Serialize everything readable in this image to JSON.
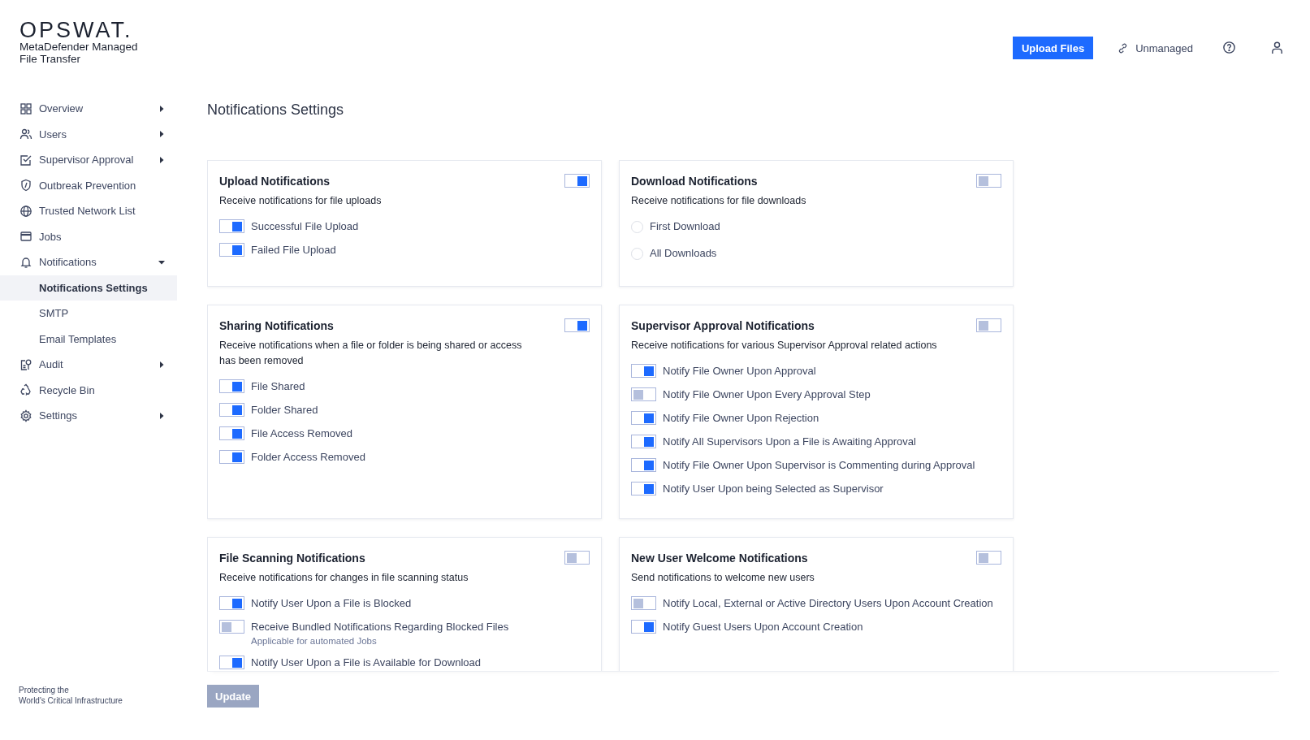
{
  "brand": {
    "logo": "OPSWAT.",
    "product_lines": [
      "MetaDefender Managed",
      "File Transfer"
    ]
  },
  "header": {
    "upload_button": "Upload Files",
    "status": "Unmanaged"
  },
  "sidebar": {
    "items": [
      {
        "label": "Overview",
        "has_submenu": true,
        "expanded": false
      },
      {
        "label": "Users",
        "has_submenu": true,
        "expanded": false
      },
      {
        "label": "Supervisor Approval",
        "has_submenu": true,
        "expanded": false
      },
      {
        "label": "Outbreak Prevention",
        "has_submenu": false
      },
      {
        "label": "Trusted Network List",
        "has_submenu": false
      },
      {
        "label": "Jobs",
        "has_submenu": false
      },
      {
        "label": "Notifications",
        "has_submenu": true,
        "expanded": true,
        "children": [
          {
            "label": "Notifications Settings",
            "selected": true
          },
          {
            "label": "SMTP",
            "selected": false
          },
          {
            "label": "Email Templates",
            "selected": false
          }
        ]
      },
      {
        "label": "Audit",
        "has_submenu": true,
        "expanded": false
      },
      {
        "label": "Recycle Bin",
        "has_submenu": false
      },
      {
        "label": "Settings",
        "has_submenu": true,
        "expanded": false
      }
    ],
    "footer_lines": [
      "Protecting the",
      "World's Critical Infrastructure"
    ]
  },
  "page": {
    "title": "Notifications Settings"
  },
  "cards": [
    {
      "title": "Upload Notifications",
      "on": true,
      "description": "Receive notifications for file uploads",
      "options": [
        {
          "kind": "toggle",
          "label": "Successful File Upload",
          "on": true
        },
        {
          "kind": "toggle",
          "label": "Failed File Upload",
          "on": true
        }
      ]
    },
    {
      "title": "Download Notifications",
      "on": false,
      "description": "Receive notifications for file downloads",
      "options": [
        {
          "kind": "radio",
          "label": "First Download",
          "selected": false
        },
        {
          "kind": "radio",
          "label": "All Downloads",
          "selected": false
        }
      ]
    },
    {
      "title": "Sharing Notifications",
      "on": true,
      "description": "Receive notifications when a file or folder is being shared or access has been removed",
      "options": [
        {
          "kind": "toggle",
          "label": "File Shared",
          "on": true
        },
        {
          "kind": "toggle",
          "label": "Folder Shared",
          "on": true
        },
        {
          "kind": "toggle",
          "label": "File Access Removed",
          "on": true
        },
        {
          "kind": "toggle",
          "label": "Folder Access Removed",
          "on": true
        }
      ]
    },
    {
      "title": "Supervisor Approval Notifications",
      "on": false,
      "description": "Receive notifications for various Supervisor Approval related actions",
      "options": [
        {
          "kind": "toggle",
          "label": "Notify File Owner Upon Approval",
          "on": true
        },
        {
          "kind": "toggle",
          "label": "Notify File Owner Upon Every Approval Step",
          "on": false
        },
        {
          "kind": "toggle",
          "label": "Notify File Owner Upon Rejection",
          "on": true
        },
        {
          "kind": "toggle",
          "label": "Notify All Supervisors Upon a File is Awaiting Approval",
          "on": true
        },
        {
          "kind": "toggle",
          "label": "Notify File Owner Upon Supervisor is Commenting during Approval",
          "on": true
        },
        {
          "kind": "toggle",
          "label": "Notify User Upon being Selected as Supervisor",
          "on": true
        }
      ]
    },
    {
      "title": "File Scanning Notifications",
      "on": false,
      "description": "Receive notifications for changes in file scanning status",
      "options": [
        {
          "kind": "toggle",
          "label": "Notify User Upon a File is Blocked",
          "on": true
        },
        {
          "kind": "toggle",
          "label": "Receive Bundled Notifications Regarding Blocked Files",
          "on": false,
          "note": "Applicable for automated Jobs"
        },
        {
          "kind": "toggle",
          "label": "Notify User Upon a File is Available for Download",
          "on": true
        }
      ]
    },
    {
      "title": "New User Welcome Notifications",
      "on": false,
      "description": "Send notifications to welcome new users",
      "options": [
        {
          "kind": "toggle",
          "label": "Notify Local, External or Active Directory Users Upon Account Creation",
          "on": false
        },
        {
          "kind": "toggle",
          "label": "Notify Guest Users Upon Account Creation",
          "on": true
        }
      ]
    }
  ],
  "update_button": {
    "label": "Update",
    "disabled": true
  }
}
